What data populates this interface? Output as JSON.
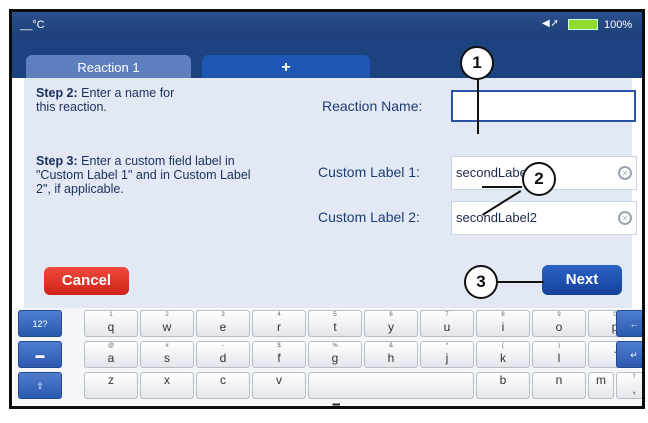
{
  "status": {
    "temperature": "__°C",
    "battery_percent": "100%",
    "signal_icon": "wifi-signal-icon",
    "battery_icon": "battery-icon"
  },
  "tabs": [
    {
      "label": "Reaction 1"
    },
    {
      "label": "+"
    }
  ],
  "steps": {
    "step2": {
      "title": "Step 2:",
      "text": "Enter a name for this reaction."
    },
    "step3": {
      "title": "Step 3:",
      "text": "Enter a custom field label in \"Custom Label 1\" and in Custom Label 2\", if applicable."
    }
  },
  "form": {
    "reaction_name_label": "Reaction Name:",
    "reaction_name_value": "",
    "custom_label_1_label": "Custom Label 1:",
    "custom_label_1_value": "secondLabe",
    "custom_label_2_label": "Custom Label 2:",
    "custom_label_2_value": "secondLabel2"
  },
  "buttons": {
    "cancel": "Cancel",
    "next": "Next"
  },
  "keyboard": {
    "row1": [
      {
        "sub": "",
        "key": "12?"
      },
      {
        "sub": "1",
        "key": "q"
      },
      {
        "sub": "2",
        "key": "w"
      },
      {
        "sub": "3",
        "key": "e"
      },
      {
        "sub": "4",
        "key": "r"
      },
      {
        "sub": "5",
        "key": "t"
      },
      {
        "sub": "6",
        "key": "y"
      },
      {
        "sub": "7",
        "key": "u"
      },
      {
        "sub": "8",
        "key": "i"
      },
      {
        "sub": "9",
        "key": "o"
      },
      {
        "sub": "0",
        "key": "p"
      },
      {
        "sub": "",
        "key": "←"
      }
    ],
    "row2": [
      {
        "sub": "",
        "key": "▬"
      },
      {
        "sub": "@",
        "key": "a"
      },
      {
        "sub": "#",
        "key": "s"
      },
      {
        "sub": "-",
        "key": "d"
      },
      {
        "sub": "$",
        "key": "f"
      },
      {
        "sub": "%",
        "key": "g"
      },
      {
        "sub": "&",
        "key": "h"
      },
      {
        "sub": "*",
        "key": "j"
      },
      {
        "sub": "(",
        "key": "k"
      },
      {
        "sub": ")",
        "key": "l"
      },
      {
        "sub": "",
        "key": "."
      },
      {
        "sub": "",
        "key": "↵"
      }
    ],
    "row3": [
      {
        "sub": "",
        "key": "⇧"
      },
      {
        "sub": "",
        "key": "z"
      },
      {
        "sub": "",
        "key": "x"
      },
      {
        "sub": "",
        "key": "c"
      },
      {
        "sub": "",
        "key": "v"
      },
      {
        "sub": "",
        "key": " "
      },
      {
        "sub": "",
        "key": "b"
      },
      {
        "sub": "",
        "key": "n"
      },
      {
        "sub": "",
        "key": "m"
      },
      {
        "sub": "?",
        "key": ","
      }
    ],
    "handle": "▪▪▪▪"
  },
  "callouts": [
    "1",
    "2",
    "3"
  ]
}
